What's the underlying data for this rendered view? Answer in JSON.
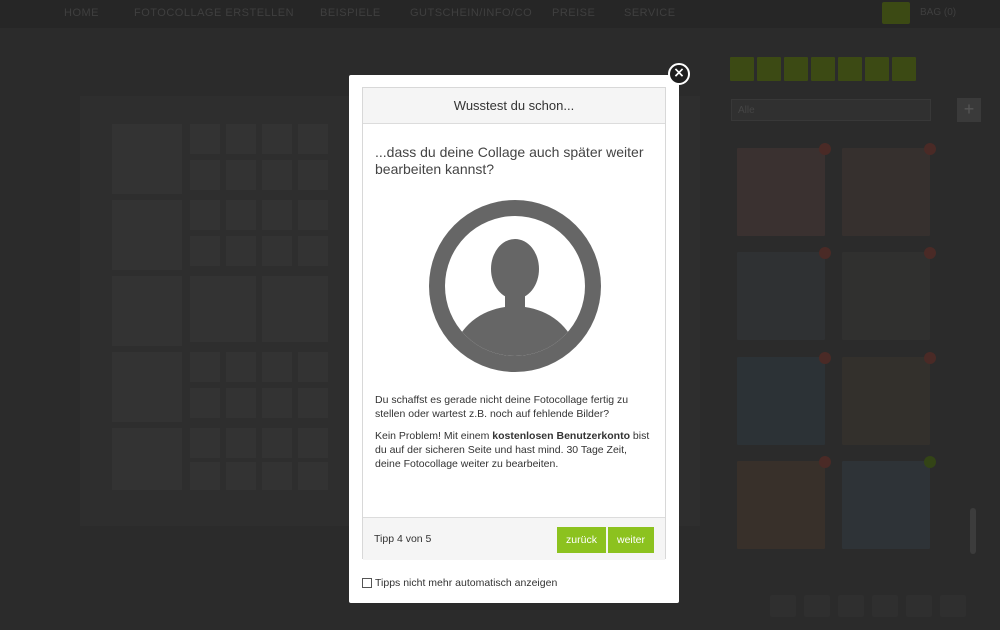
{
  "nav": {
    "items": [
      "HOME",
      "FOTOCOLLAGE ERSTELLEN",
      "BEISPIELE",
      "GUTSCHEIN/INFO/CO",
      "PREISE",
      "SERVICE"
    ],
    "cart_label": "BAG (0)"
  },
  "sidebar": {
    "select_value": "Alle"
  },
  "modal": {
    "title": "Wusstest du schon...",
    "heading": "...dass du deine Collage auch später weiter bearbeiten kannst?",
    "paragraph1": "Du schaffst es gerade nicht deine Fotocollage fertig zu stellen oder wartest z.B. noch auf fehlende Bilder?",
    "paragraph2_prefix": "Kein Problem! Mit einem ",
    "paragraph2_bold": "kostenlosen Benutzerkonto",
    "paragraph2_suffix": " bist du auf der sicheren Seite und hast mind. 30 Tage Zeit, deine Fotocollage weiter zu bearbeiten.",
    "tip_counter": "Tipp 4 von 5",
    "back_label": "zurück",
    "next_label": "weiter",
    "checkbox_label": "Tipps nicht mehr automatisch anzeigen",
    "checkbox_checked": false,
    "close_symbol": "×"
  },
  "colors": {
    "accent_green": "#8cc21f",
    "overlay_dark": "#2b2b2b",
    "avatar_gray": "#666666"
  }
}
